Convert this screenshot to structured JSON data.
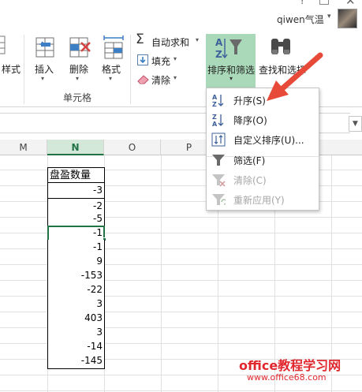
{
  "window": {
    "help": "?",
    "close": "✕",
    "user": "qiwen气温",
    "user_caret": "▾"
  },
  "ribbon": {
    "style_btn": "样式",
    "insert_btn": "插入",
    "delete_btn": "删除",
    "format_btn": "格式",
    "cells_group": "单元格",
    "autosum": "自动求和",
    "fill": "填充",
    "clear": "清除",
    "sort_filter": "排序和筛选",
    "find_select": "查找和选择",
    "caret": "▾"
  },
  "formula_bar": {
    "dropdown": "▼"
  },
  "grid": {
    "col_heads": [
      "M",
      "N",
      "O",
      "P"
    ],
    "active_col": "N",
    "header_cell": "盘盈数量",
    "values": [
      "-3",
      "-2",
      "-5",
      "-1",
      "-1",
      "9",
      "-153",
      "-22",
      "3",
      "403",
      "3",
      "-14",
      "-145"
    ],
    "selected_index": 3
  },
  "menu": {
    "items": [
      {
        "label": "升序(S)",
        "icon": "sort-ascending-icon",
        "enabled": true
      },
      {
        "label": "降序(O)",
        "icon": "sort-descending-icon",
        "enabled": true
      },
      {
        "label": "自定义排序(U)...",
        "icon": "custom-sort-icon",
        "enabled": true
      },
      {
        "label": "筛选(F)",
        "icon": "filter-icon",
        "enabled": true
      },
      {
        "label": "清除(C)",
        "icon": "clear-filter-icon",
        "enabled": false
      },
      {
        "label": "重新应用(Y)",
        "icon": "reapply-filter-icon",
        "enabled": false
      }
    ]
  },
  "annotation": {
    "arrow_color": "#e84a3a"
  },
  "watermark": {
    "line1": "office教程学习网",
    "line2": "www.office68.com"
  },
  "colors": {
    "accent_green": "#217346",
    "highlight": "#a9d9b9",
    "watermark_red": "#e0282e"
  }
}
